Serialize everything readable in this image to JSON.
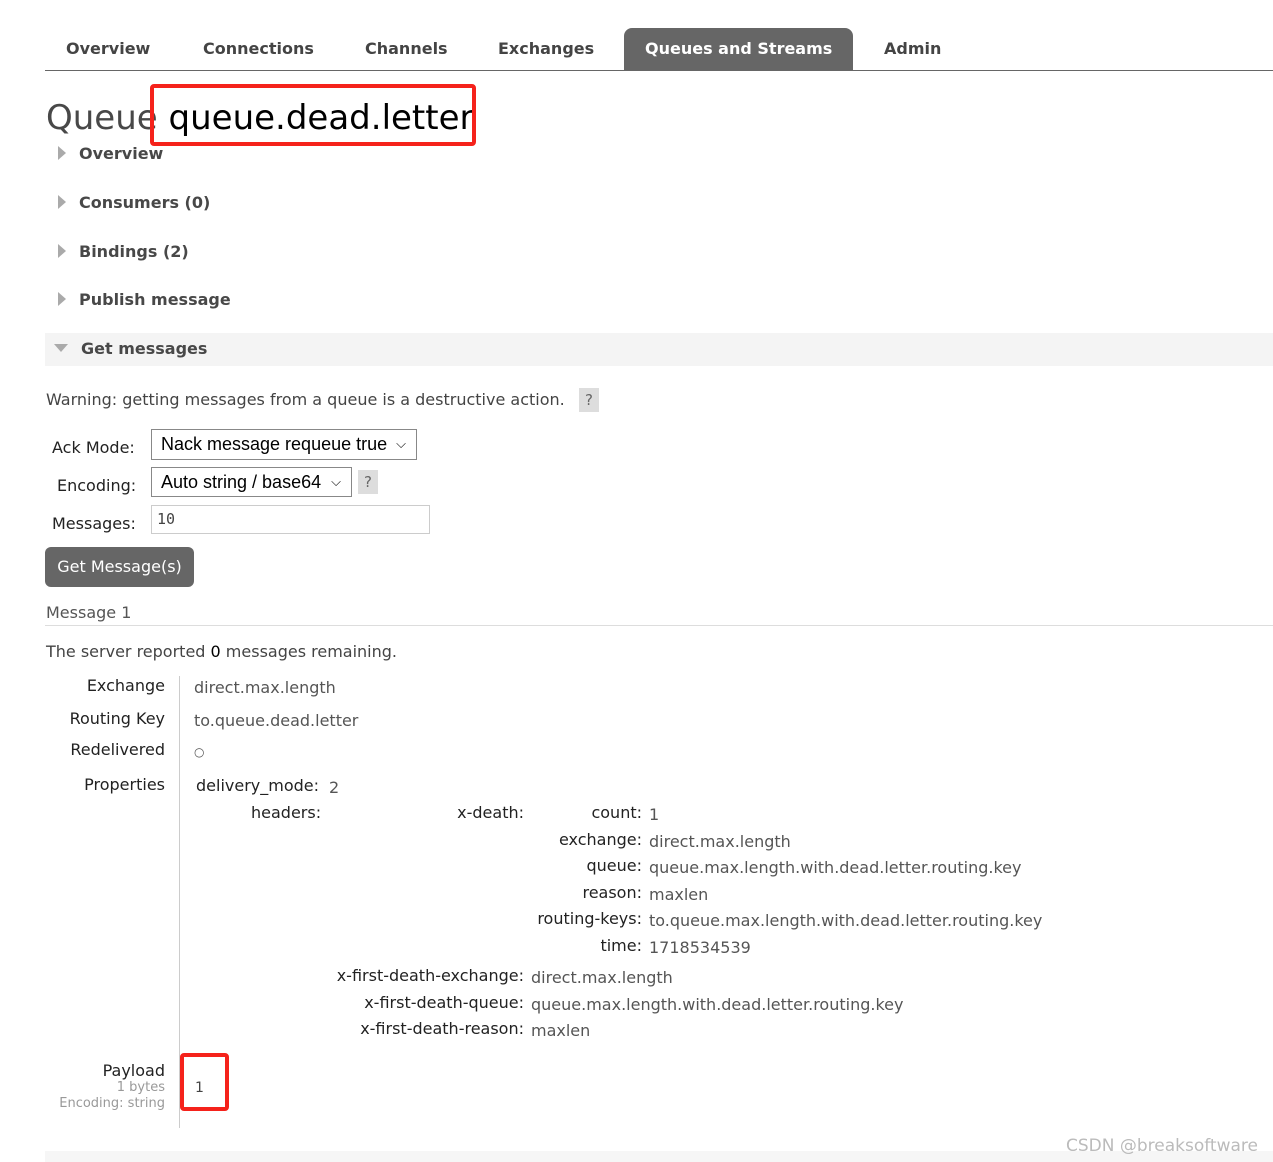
{
  "nav": {
    "tabs": [
      {
        "label": "Overview"
      },
      {
        "label": "Connections"
      },
      {
        "label": "Channels"
      },
      {
        "label": "Exchanges"
      },
      {
        "label": "Queues and Streams",
        "active": true
      },
      {
        "label": "Admin"
      }
    ]
  },
  "page": {
    "prefix": "Queue",
    "name": "queue.dead.letter"
  },
  "sections": {
    "overview": "Overview",
    "consumers": "Consumers (0)",
    "bindings": "Bindings (2)",
    "publish": "Publish message",
    "get": "Get messages"
  },
  "get_messages": {
    "warning": "Warning: getting messages from a queue is a destructive action.",
    "help": "?",
    "ack_mode_label": "Ack Mode:",
    "ack_mode_value": "Nack message requeue true",
    "encoding_label": "Encoding:",
    "encoding_value": "Auto string / base64",
    "messages_label": "Messages:",
    "messages_value": "10",
    "button": "Get Message(s)"
  },
  "message": {
    "title": "Message 1",
    "remaining_pre": "The server reported ",
    "remaining_count": "0",
    "remaining_post": " messages remaining.",
    "exchange_label": "Exchange",
    "exchange": "direct.max.length",
    "routing_key_label": "Routing Key",
    "routing_key": "to.queue.dead.letter",
    "redelivered_label": "Redelivered",
    "redelivered": "○",
    "properties_label": "Properties",
    "delivery_mode_label": "delivery_mode:",
    "delivery_mode": "2",
    "headers_label": "headers:",
    "x_death_label": "x-death:",
    "x_death": [
      {
        "k": "count:",
        "v": "1"
      },
      {
        "k": "exchange:",
        "v": "direct.max.length"
      },
      {
        "k": "queue:",
        "v": "queue.max.length.with.dead.letter.routing.key"
      },
      {
        "k": "reason:",
        "v": "maxlen"
      },
      {
        "k": "routing-keys:",
        "v": "to.queue.max.length.with.dead.letter.routing.key"
      },
      {
        "k": "time:",
        "v": "1718534539"
      }
    ],
    "first_death": [
      {
        "k": "x-first-death-exchange:",
        "v": "direct.max.length"
      },
      {
        "k": "x-first-death-queue:",
        "v": "queue.max.length.with.dead.letter.routing.key"
      },
      {
        "k": "x-first-death-reason:",
        "v": "maxlen"
      }
    ],
    "payload_label": "Payload",
    "payload_size": "1 bytes",
    "payload_encoding": "Encoding: string",
    "payload": "1"
  },
  "watermark": "CSDN @breaksoftware",
  "colors": {
    "highlight": "#f5221b",
    "active_tab": "#666666"
  }
}
